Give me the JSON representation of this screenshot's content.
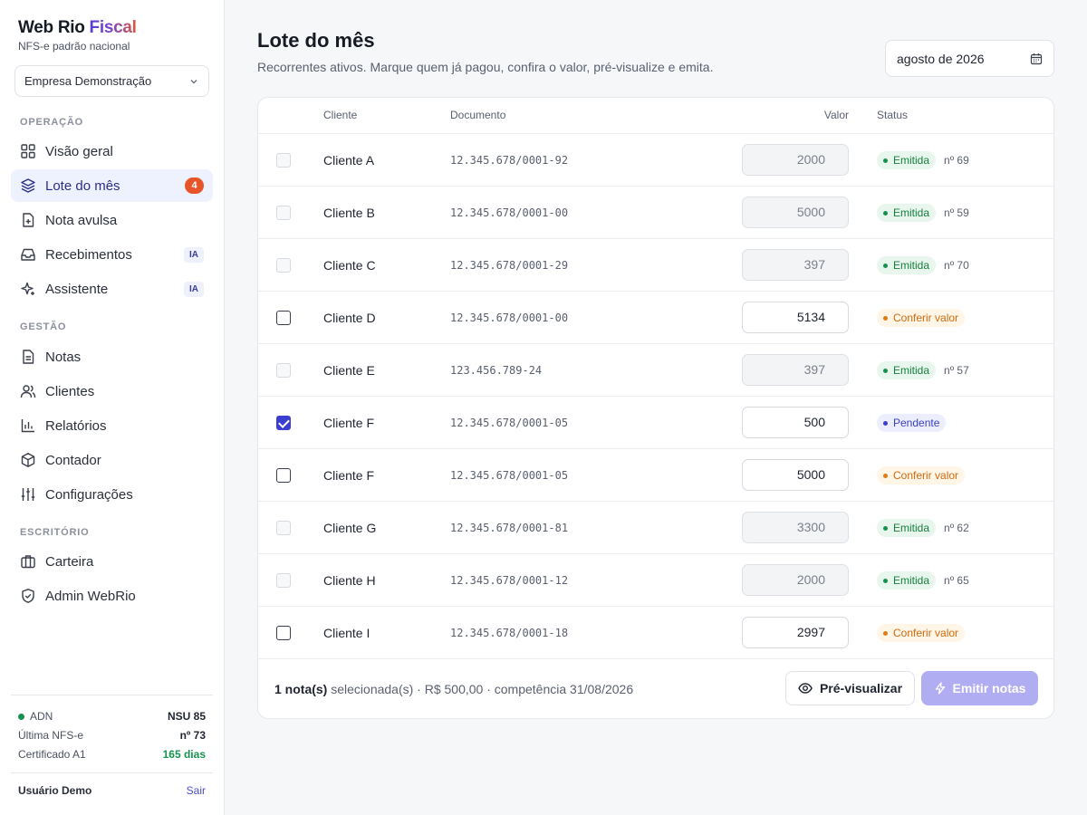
{
  "brand": {
    "name_part1": "Web Rio",
    "name_part2": "Fiscal",
    "subtitle": "NFS-e padrão nacional"
  },
  "company_selector": {
    "value": "Empresa Demonstração"
  },
  "sidebar": {
    "sections": [
      {
        "label": "OPERAÇÃO"
      },
      {
        "label": "GESTÃO"
      },
      {
        "label": "ESCRITÓRIO"
      }
    ],
    "items": [
      {
        "label": "Visão geral",
        "icon": "grid-icon"
      },
      {
        "label": "Lote do mês",
        "icon": "layers-icon",
        "badge": "4",
        "active": true
      },
      {
        "label": "Nota avulsa",
        "icon": "file-plus-icon"
      },
      {
        "label": "Recebimentos",
        "icon": "inbox-icon",
        "tag": "IA"
      },
      {
        "label": "Assistente",
        "icon": "sparkles-icon",
        "tag": "IA"
      },
      {
        "label": "Notas",
        "icon": "file-text-icon"
      },
      {
        "label": "Clientes",
        "icon": "users-icon"
      },
      {
        "label": "Relatórios",
        "icon": "bar-chart-icon"
      },
      {
        "label": "Contador",
        "icon": "box-icon"
      },
      {
        "label": "Configurações",
        "icon": "sliders-icon"
      },
      {
        "label": "Carteira",
        "icon": "briefcase-icon"
      },
      {
        "label": "Admin WebRio",
        "icon": "shield-icon"
      }
    ],
    "footer": {
      "adn_label": "ADN",
      "adn_value": "NSU 85",
      "last_label": "Última NFS-e",
      "last_value": "nº 73",
      "cert_label": "Certificado A1",
      "cert_value": "165 dias",
      "user": "Usuário Demo",
      "logout": "Sair"
    }
  },
  "header": {
    "title": "Lote do mês",
    "subtitle": "Recorrentes ativos. Marque quem já pagou, confira o valor, pré-visualize e emita.",
    "month": "agosto de 2026"
  },
  "table": {
    "columns": {
      "cliente": "Cliente",
      "documento": "Documento",
      "valor": "Valor",
      "status": "Status"
    },
    "rows": [
      {
        "cliente": "Cliente A",
        "documento": "12.345.678/0001-92",
        "valor": "2000",
        "status": "Emitida",
        "status_type": "ok",
        "numero": "nº 69",
        "checkbox": "disabled"
      },
      {
        "cliente": "Cliente B",
        "documento": "12.345.678/0001-00",
        "valor": "5000",
        "status": "Emitida",
        "status_type": "ok",
        "numero": "nº 59",
        "checkbox": "disabled"
      },
      {
        "cliente": "Cliente C",
        "documento": "12.345.678/0001-29",
        "valor": "397",
        "status": "Emitida",
        "status_type": "ok",
        "numero": "nº 70",
        "checkbox": "disabled"
      },
      {
        "cliente": "Cliente D",
        "documento": "12.345.678/0001-00",
        "valor": "5134",
        "status": "Conferir valor",
        "status_type": "warn",
        "numero": "",
        "checkbox": "unchecked"
      },
      {
        "cliente": "Cliente E",
        "documento": "123.456.789-24",
        "valor": "397",
        "status": "Emitida",
        "status_type": "ok",
        "numero": "nº 57",
        "checkbox": "disabled"
      },
      {
        "cliente": "Cliente F",
        "documento": "12.345.678/0001-05",
        "valor": "500",
        "status": "Pendente",
        "status_type": "pend",
        "numero": "",
        "checkbox": "checked"
      },
      {
        "cliente": "Cliente F",
        "documento": "12.345.678/0001-05",
        "valor": "5000",
        "status": "Conferir valor",
        "status_type": "warn",
        "numero": "",
        "checkbox": "unchecked"
      },
      {
        "cliente": "Cliente G",
        "documento": "12.345.678/0001-81",
        "valor": "3300",
        "status": "Emitida",
        "status_type": "ok",
        "numero": "nº 62",
        "checkbox": "disabled"
      },
      {
        "cliente": "Cliente H",
        "documento": "12.345.678/0001-12",
        "valor": "2000",
        "status": "Emitida",
        "status_type": "ok",
        "numero": "nº 65",
        "checkbox": "disabled"
      },
      {
        "cliente": "Cliente I",
        "documento": "12.345.678/0001-18",
        "valor": "2997",
        "status": "Conferir valor",
        "status_type": "warn",
        "numero": "",
        "checkbox": "unchecked"
      }
    ]
  },
  "footer": {
    "selected_count": "1 nota(s)",
    "summary": "selecionada(s) · R$ 500,00 · competência 31/08/2026",
    "preview_label": "Pré-visualizar",
    "emit_label": "Emitir notas"
  },
  "colors": {
    "accent": "#3b3fd0",
    "emit_disabled": "#b1adf3",
    "ok": "#15803d",
    "warn": "#d06a0c",
    "badge": "#e8542a"
  }
}
